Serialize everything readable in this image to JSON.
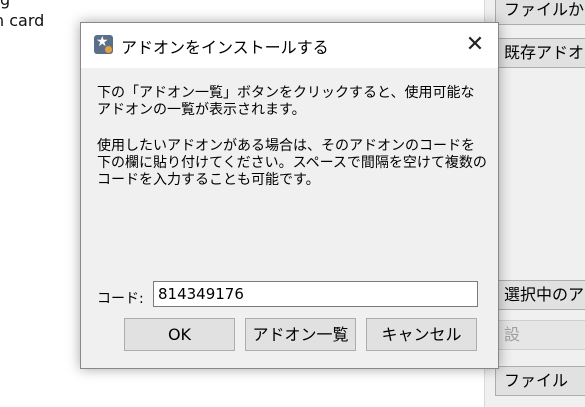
{
  "background": {
    "top_text": "g",
    "card_text": "n card",
    "right_buttons": [
      {
        "label": "ファイルから"
      },
      {
        "label": "既存アドオン"
      },
      {
        "label": "選択中のア"
      },
      {
        "label": "設"
      },
      {
        "label": "ファイル"
      }
    ]
  },
  "dialog": {
    "title": "アドオンをインストールする",
    "close_glyph": "✕",
    "para1": "下の「アドオン一覧」ボタンをクリックすると、使用可能なアドオンの一覧が表示されます。",
    "para2": "使用したいアドオンがある場合は、そのアドオンのコードを下の欄に貼り付けてください。スペースで間隔を空けて複数のコードを入力することも可能です。",
    "code_label": "コード:",
    "code_value": "814349176",
    "ok_label": "OK",
    "list_label": "アドオン一覧",
    "cancel_label": "キャンセル"
  },
  "colors": {
    "dialog_bg": "#f0f0f0",
    "button_bg": "#e1e1e1",
    "icon_bg": "#5b6f88",
    "icon_accent": "#e6a23c"
  },
  "icons": [
    "anki-app-icon",
    "close-icon"
  ]
}
